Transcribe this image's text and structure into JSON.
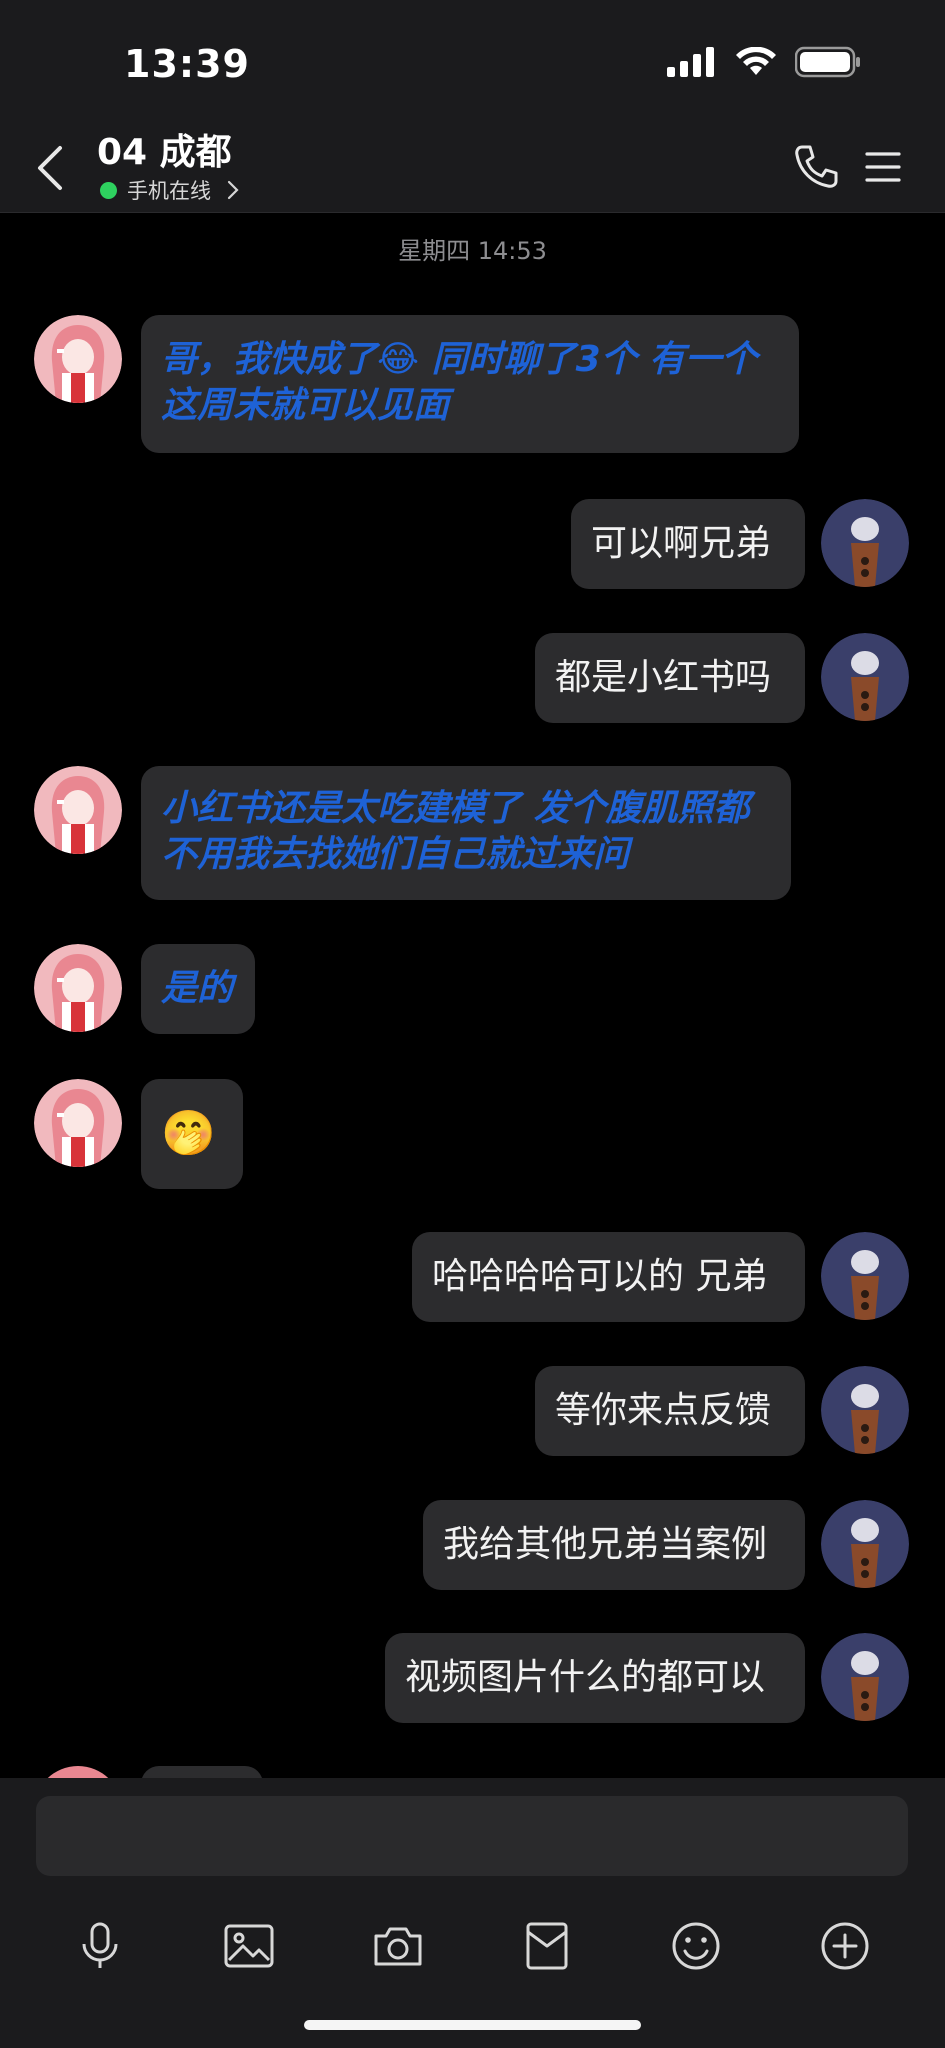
{
  "status": {
    "time": "13:39"
  },
  "header": {
    "title": "04 成都",
    "subtitle": "手机在线"
  },
  "chat": {
    "timestamp": "星期四 14:53",
    "messages": [
      {
        "side": "left",
        "lines": [
          "哥，我快成了😂 同时聊了3个 有一个",
          "这周末就可以见面"
        ]
      },
      {
        "side": "right",
        "lines": [
          "可以啊兄弟"
        ]
      },
      {
        "side": "right",
        "lines": [
          "都是小红书吗"
        ]
      },
      {
        "side": "left",
        "lines": [
          "小红书还是太吃建模了 发个腹肌照都",
          "不用我去找她们自己就过来问"
        ]
      },
      {
        "side": "left",
        "lines": [
          "是的"
        ]
      },
      {
        "side": "left",
        "lines": [
          "🤭"
        ]
      },
      {
        "side": "right",
        "lines": [
          "哈哈哈哈可以的 兄弟"
        ]
      },
      {
        "side": "right",
        "lines": [
          "等你来点反馈"
        ]
      },
      {
        "side": "right",
        "lines": [
          "我给其他兄弟当案例"
        ]
      },
      {
        "side": "right",
        "lines": [
          "视频图片什么的都可以"
        ]
      }
    ]
  },
  "toolbar": {
    "items": [
      "mic-icon",
      "image-icon",
      "camera-icon",
      "redpacket-icon",
      "emoji-icon",
      "plus-icon"
    ]
  },
  "colors": {
    "accent_blue": "#1e62d6",
    "online": "#2ed15f",
    "bubble": "#2c2c2e"
  }
}
